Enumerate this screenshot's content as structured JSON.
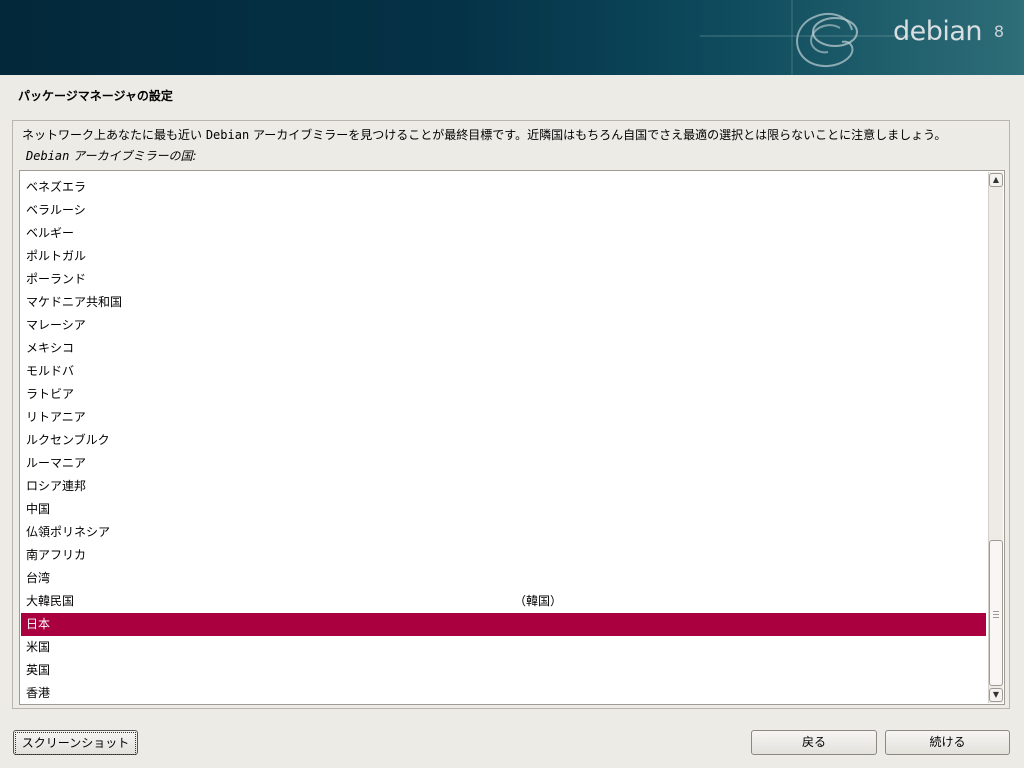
{
  "banner": {
    "logo_text": "debian",
    "logo_version": "8"
  },
  "page": {
    "title": "パッケージマネージャの設定",
    "description_part1": "ネットワーク上あなたに最も近い ",
    "description_mono": "Debian",
    "description_part2": " アーカイブミラーを見つけることが最終目標です。近隣国はもちろん自国でさえ最適の選択とは限らないことに注意しましょう。",
    "prompt_mono": "Debian",
    "prompt_rest": " アーカイブミラーの国:"
  },
  "countries": [
    {
      "name": "ベネズエラ",
      "note": ""
    },
    {
      "name": "ベラルーシ",
      "note": ""
    },
    {
      "name": "ベルギー",
      "note": ""
    },
    {
      "name": "ポルトガル",
      "note": ""
    },
    {
      "name": "ポーランド",
      "note": ""
    },
    {
      "name": "マケドニア共和国",
      "note": ""
    },
    {
      "name": "マレーシア",
      "note": ""
    },
    {
      "name": "メキシコ",
      "note": ""
    },
    {
      "name": "モルドバ",
      "note": ""
    },
    {
      "name": "ラトビア",
      "note": ""
    },
    {
      "name": "リトアニア",
      "note": ""
    },
    {
      "name": "ルクセンブルク",
      "note": ""
    },
    {
      "name": "ルーマニア",
      "note": ""
    },
    {
      "name": "ロシア連邦",
      "note": ""
    },
    {
      "name": "中国",
      "note": ""
    },
    {
      "name": "仏領ポリネシア",
      "note": ""
    },
    {
      "name": "南アフリカ",
      "note": ""
    },
    {
      "name": "台湾",
      "note": ""
    },
    {
      "name": "大韓民国",
      "note": "（韓国）"
    },
    {
      "name": "日本",
      "note": ""
    },
    {
      "name": "米国",
      "note": ""
    },
    {
      "name": "英国",
      "note": ""
    },
    {
      "name": "香港",
      "note": ""
    }
  ],
  "selected_country": "日本",
  "buttons": {
    "screenshot": "スクリーンショット",
    "back": "戻る",
    "continue": "続ける"
  },
  "colors": {
    "selection": "#ab0040",
    "banner": "#053247"
  }
}
